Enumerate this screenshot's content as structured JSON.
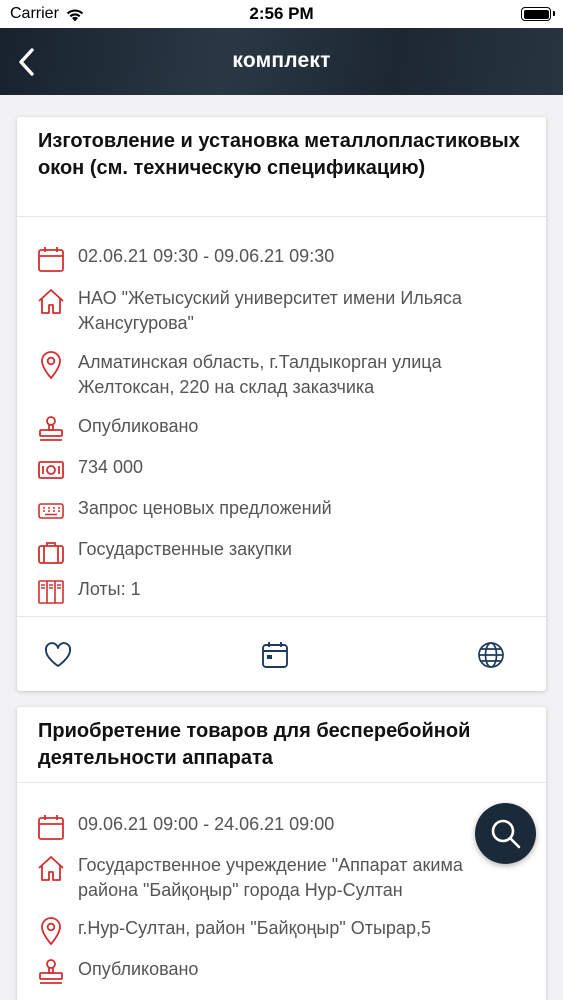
{
  "status_bar": {
    "carrier": "Carrier",
    "time": "2:56 PM"
  },
  "nav": {
    "title": "комплект",
    "back_icon": "chevron-left-icon"
  },
  "colors": {
    "accent": "#d32f2f",
    "nav_bg": "#1f2b36",
    "action_icon": "#1f3a5f"
  },
  "tenders": [
    {
      "title": "Изготовление и установка металлопластиковых окон (см. техническую спецификацию)",
      "dates": "02.06.21 09:30 - 09.06.21 09:30",
      "customer": "НАО \"Жетысуский университет имени Ильяса Жансугурова\"",
      "location": "Алматинская область, г.Талдыкорган улица Желтоксан, 220 на склад заказчика",
      "status": "Опубликовано",
      "amount": "734 000",
      "method": "Запрос ценовых предложений",
      "type": "Государственные закупки",
      "lots": "Лоты: 1"
    },
    {
      "title": "Приобретение товаров для бесперебойной деятельности аппарата",
      "dates": "09.06.21 09:00 - 24.06.21 09:00",
      "customer": "Государственное учреждение \"Аппарат акима района \"Байқоңыр\" города Нур-Султан",
      "location": "г.Нур-Султан, район \"Байқоңыр\" Отырар,5",
      "status": "Опубликовано"
    }
  ]
}
